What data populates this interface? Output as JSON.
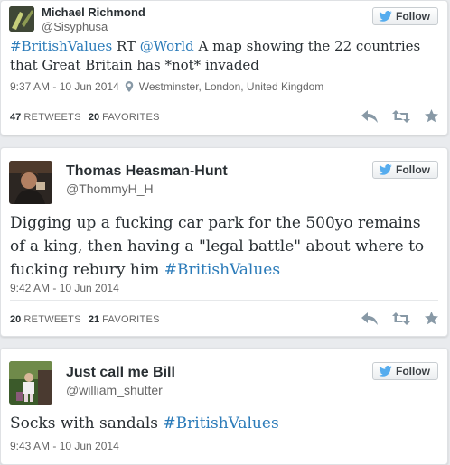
{
  "follow_label": "Follow",
  "tweets": [
    {
      "name": "Michael Richmond",
      "handle": "@Sisyphusa",
      "hashtag": "#BritishValues",
      "text_a": " RT ",
      "mention": "@World",
      "text_b": " A map showing the 22 countries that Great Britain has *not* invaded",
      "timestamp": "9:37 AM - 10 Jun 2014",
      "location": "Westminster, London, United Kingdom",
      "retweets": "47",
      "retweets_label": "RETWEETS",
      "favorites": "20",
      "favorites_label": "FAVORITES"
    },
    {
      "name": "Thomas Heasman-Hunt",
      "handle": "@ThommyH_H",
      "text": "Digging up a fucking car park for the 500yo remains of a king, then having a \"legal battle\" about where to fucking rebury him ",
      "hashtag": "#BritishValues",
      "timestamp": "9:42 AM - 10 Jun 2014",
      "retweets": "20",
      "retweets_label": "RETWEETS",
      "favorites": "21",
      "favorites_label": "FAVORITES"
    },
    {
      "name": "Just call me Bill",
      "handle": "@william_shutter",
      "text": "Socks with sandals ",
      "hashtag": "#BritishValues",
      "timestamp": "9:43 AM - 10 Jun 2014"
    }
  ],
  "icons": [
    "twitter-bird-icon",
    "location-pin-icon",
    "reply-icon",
    "retweet-icon",
    "favorite-star-icon"
  ],
  "colors": {
    "link": "#2b7bb9",
    "text": "#292f33",
    "muted": "#666666",
    "bird": "#55acee"
  }
}
